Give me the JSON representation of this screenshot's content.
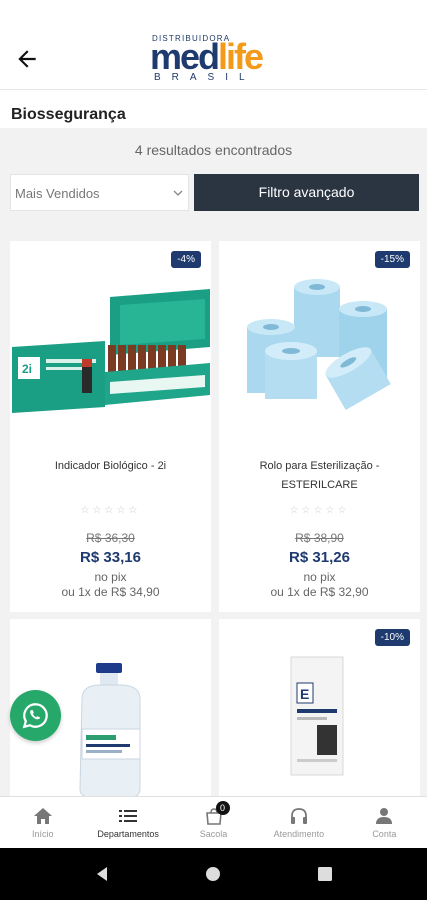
{
  "header": {
    "logo_top": "DISTRIBUIDORA",
    "logo_med": "med",
    "logo_life": "life",
    "logo_bottom": "BRASIL"
  },
  "page": {
    "title": "Biossegurança",
    "results_text": "4 resultados encontrados",
    "sort_value": "Mais Vendidos",
    "filter_label": "Filtro avançado"
  },
  "products": [
    {
      "discount": "-4%",
      "name": "Indicador Biológico - 2i",
      "stars": "☆☆☆☆☆",
      "old_price": "R$ 36,30",
      "price": "R$ 33,16",
      "pix": "no pix",
      "installment": "ou 1x de R$ 34,90"
    },
    {
      "discount": "-15%",
      "name": "Rolo para Esterilização - ESTERILCARE",
      "stars": "☆☆☆☆☆",
      "old_price": "R$ 38,90",
      "price": "R$ 31,26",
      "pix": "no pix",
      "installment": "ou 1x de R$ 32,90"
    },
    {
      "discount": "",
      "name": "",
      "stars": "",
      "old_price": "",
      "price": "",
      "pix": "",
      "installment": ""
    },
    {
      "discount": "-10%",
      "name": "",
      "stars": "",
      "old_price": "",
      "price": "",
      "pix": "",
      "installment": ""
    }
  ],
  "bottom_nav": [
    {
      "label": "Início",
      "icon": "home-icon"
    },
    {
      "label": "Departamentos",
      "icon": "list-icon"
    },
    {
      "label": "Sacola",
      "icon": "bag-icon",
      "count": "0"
    },
    {
      "label": "Atendimento",
      "icon": "headset-icon"
    },
    {
      "label": "Conta",
      "icon": "user-icon"
    }
  ],
  "colors": {
    "brand_blue": "#1e3a6e",
    "brand_orange": "#f39a1b",
    "filter_button": "#2b3441",
    "whatsapp": "#25a86a"
  }
}
